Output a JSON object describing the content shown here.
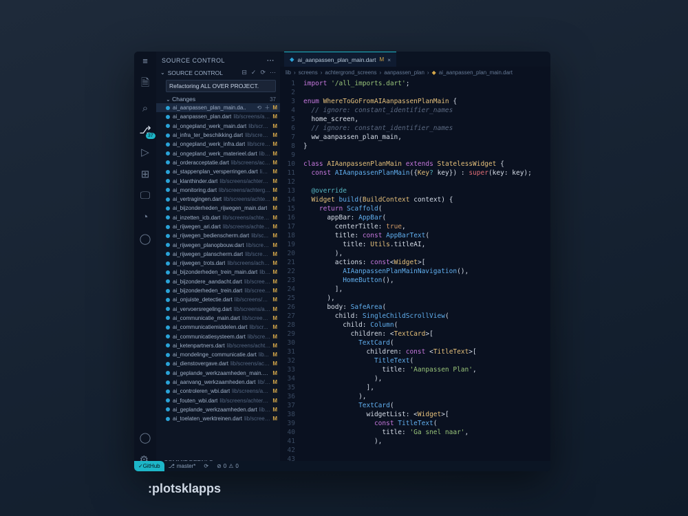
{
  "caption": ":plotsklapps",
  "activity_badge": "37",
  "sidebar": {
    "title": "SOURCE CONTROL",
    "section": "SOURCE CONTROL",
    "commit_msg": "Refactoring ALL OVER PROJECT.",
    "changes_label": "Changes",
    "changes_count": "37",
    "commit_details": "COMMIT DETAILS"
  },
  "files": [
    {
      "n": "ai_aanpassen_plan_main.da..",
      "p": "",
      "sel": true,
      "act": "⟲ ＋"
    },
    {
      "n": "ai_aanpassen_plan.dart",
      "p": "lib/screens/acht..."
    },
    {
      "n": "ai_ongepland_werk_main.dart",
      "p": "lib/scree..."
    },
    {
      "n": "ai_infra_ter_beschikking.dart",
      "p": "lib/screen..."
    },
    {
      "n": "ai_ongepland_werk_infra.dart",
      "p": "lib/scree..."
    },
    {
      "n": "ai_ongepland_werk_materieel.dart",
      "p": "lib/..."
    },
    {
      "n": "ai_orderacceptatie.dart",
      "p": "lib/screens/ach..."
    },
    {
      "n": "ai_stappenplan_versperringen.dart",
      "p": "lib/..."
    },
    {
      "n": "ai_klanthinder.dart",
      "p": "lib/screens/achtergr..."
    },
    {
      "n": "ai_monitoring.dart",
      "p": "lib/screens/achtergr..."
    },
    {
      "n": "ai_vertragingen.dart",
      "p": "lib/screens/achterg..."
    },
    {
      "n": "ai_bijzonderheden_rijwegen_main.dart",
      "p": ""
    },
    {
      "n": "ai_inzetten_icb.dart",
      "p": "lib/screens/achterg..."
    },
    {
      "n": "ai_rijwegen_ari.dart",
      "p": "lib/screens/achterg..."
    },
    {
      "n": "ai_rijwegen_bedienscherm.dart",
      "p": "lib/sc..."
    },
    {
      "n": "ai_rijwegen_planopbouw.dart",
      "p": "lib/scree..."
    },
    {
      "n": "ai_rijwegen_planscherm.dart",
      "p": "lib/screen..."
    },
    {
      "n": "ai_rijwegen_trots.dart",
      "p": "lib/screens/achter..."
    },
    {
      "n": "ai_bijzonderheden_trein_main.dart",
      "p": "lib/..."
    },
    {
      "n": "ai_bijzondere_aandacht.dart",
      "p": "lib/screen..."
    },
    {
      "n": "ai_bijzonderheden_trein.dart",
      "p": "lib/screen..."
    },
    {
      "n": "ai_onjuiste_detectie.dart",
      "p": "lib/screens/ac..."
    },
    {
      "n": "ai_vervoersregeling.dart",
      "p": "lib/screens/ac..."
    },
    {
      "n": "ai_communicatie_main.dart",
      "p": "lib/screens..."
    },
    {
      "n": "ai_communicatiemiddelen.dart",
      "p": "lib/scr..."
    },
    {
      "n": "ai_communicatiesysteem.dart",
      "p": "lib/scree..."
    },
    {
      "n": "ai_ketenpartners.dart",
      "p": "lib/screens/achter..."
    },
    {
      "n": "ai_mondelinge_communicatie.dart",
      "p": "lib..."
    },
    {
      "n": "ai_dienstovergave.dart",
      "p": "lib/screens/acht..."
    },
    {
      "n": "ai_geplande_werkzaamheden_main.da..",
      "p": ""
    },
    {
      "n": "ai_aanvang_werkzaamheden.dart",
      "p": "lib/s..."
    },
    {
      "n": "ai_controleren_wbi.dart",
      "p": "lib/screens/ach..."
    },
    {
      "n": "ai_fouten_wbi.dart",
      "p": "lib/screens/achtergro..."
    },
    {
      "n": "ai_geplande_werkzaamheden.dart",
      "p": "lib/..."
    },
    {
      "n": "ai_toelaten_werktreinen.dart",
      "p": "lib/screen..."
    }
  ],
  "tab": {
    "name": "ai_aanpassen_plan_main.dart",
    "m": "M"
  },
  "breadcrumb": {
    "p1": "lib",
    "p2": "screens",
    "p3": "achtergrond_screens",
    "p4": "aanpassen_plan",
    "p5": "ai_aanpassen_plan_main.dart"
  },
  "status": {
    "github": "GitHub",
    "branch": "master*",
    "errs": "0",
    "warns": "0"
  },
  "lines": [
    "1",
    "2",
    "3",
    "4",
    "5",
    "6",
    "7",
    "8",
    "9",
    "10",
    "11",
    "12",
    "13",
    "14",
    "15",
    "16",
    "17",
    "18",
    "19",
    "20",
    "21",
    "22",
    "23",
    "24",
    "25",
    "26",
    "27",
    "28",
    "29",
    "30",
    "31",
    "32",
    "33",
    "34",
    "35",
    "36",
    "37",
    "38",
    "39",
    "40",
    "41",
    "42",
    "43"
  ]
}
